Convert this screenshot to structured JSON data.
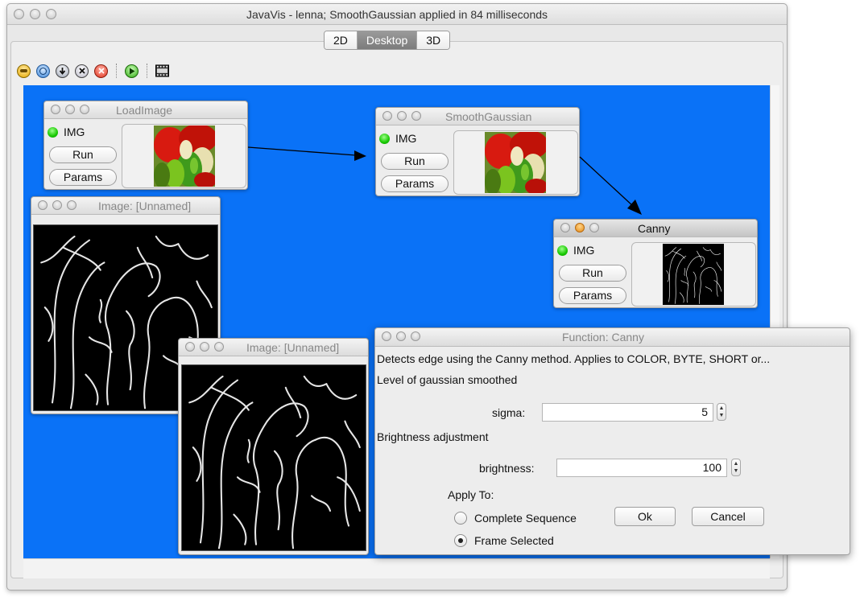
{
  "window": {
    "title": "JavaVis - lenna; SmoothGaussian applied in 84 milliseconds",
    "tabs": [
      "2D",
      "Desktop",
      "3D"
    ],
    "selected_tab": "Desktop"
  },
  "toolbar": {
    "icons": [
      "open-icon",
      "globe-icon",
      "download-icon",
      "close-circle-icon",
      "stop-icon",
      "play-icon",
      "film-strip-icon"
    ]
  },
  "nodes": {
    "load": {
      "title": "LoadImage",
      "port": "IMG",
      "run": "Run",
      "params": "Params"
    },
    "smooth": {
      "title": "SmoothGaussian",
      "port": "IMG",
      "run": "Run",
      "params": "Params"
    },
    "canny": {
      "title": "Canny",
      "port": "IMG",
      "run": "Run",
      "params": "Params"
    }
  },
  "image_windows": {
    "first": {
      "title": "Image: [Unnamed]"
    },
    "second": {
      "title": "Image: [Unnamed]"
    }
  },
  "dialog": {
    "title": "Function: Canny",
    "description": "Detects edge using the Canny method. Applies to COLOR, BYTE, SHORT or...",
    "section_smooth": "Level of gaussian smoothed",
    "sigma_label": "sigma:",
    "sigma_value": "5",
    "section_brightness": "Brightness adjustment",
    "brightness_label": "brightness:",
    "brightness_value": "100",
    "apply_to_label": "Apply To:",
    "option_sequence": "Complete Sequence",
    "option_frame": "Frame Selected",
    "selected_option": "Frame Selected",
    "ok_label": "Ok",
    "cancel_label": "Cancel"
  },
  "colors": {
    "desktop": "#0a72f7",
    "port_green": "#17c800"
  }
}
